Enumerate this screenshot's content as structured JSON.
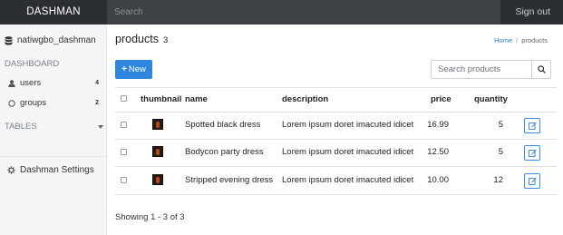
{
  "app": {
    "brand": "DASHMAN",
    "search_placeholder": "Search",
    "signout": "Sign out"
  },
  "sidebar": {
    "database": "natiwgbo_dashman",
    "dashboard_heading": "DASHBOARD",
    "items": [
      {
        "label": "users",
        "count": "4"
      },
      {
        "label": "groups",
        "count": "2"
      }
    ],
    "tables_heading": "TABLES",
    "settings": "Dashman Settings"
  },
  "page": {
    "title": "products",
    "count": "3",
    "breadcrumb": {
      "home": "Home",
      "sep": "/",
      "current": "products"
    },
    "new_button": "New",
    "search_placeholder": "Search products"
  },
  "table": {
    "columns": [
      "thumbnail",
      "name",
      "description",
      "price",
      "quantity"
    ],
    "rows": [
      {
        "name": "Spotted black dress",
        "description": "Lorem ipsum doret imacuted idicet",
        "price": "16.99",
        "quantity": "5"
      },
      {
        "name": "Bodycon party dress",
        "description": "Lorem ipsum doret imacuted idicet",
        "price": "12.50",
        "quantity": "5"
      },
      {
        "name": "Stripped evening dress",
        "description": "Lorem ipsum doret imacuted idicet",
        "price": "10.00",
        "quantity": "12"
      }
    ]
  },
  "footer": "Showing 1 - 3 of 3",
  "colors": {
    "topbar": "#2b2e33",
    "accent": "#2e86de",
    "sidebar": "#f4f5f7"
  }
}
